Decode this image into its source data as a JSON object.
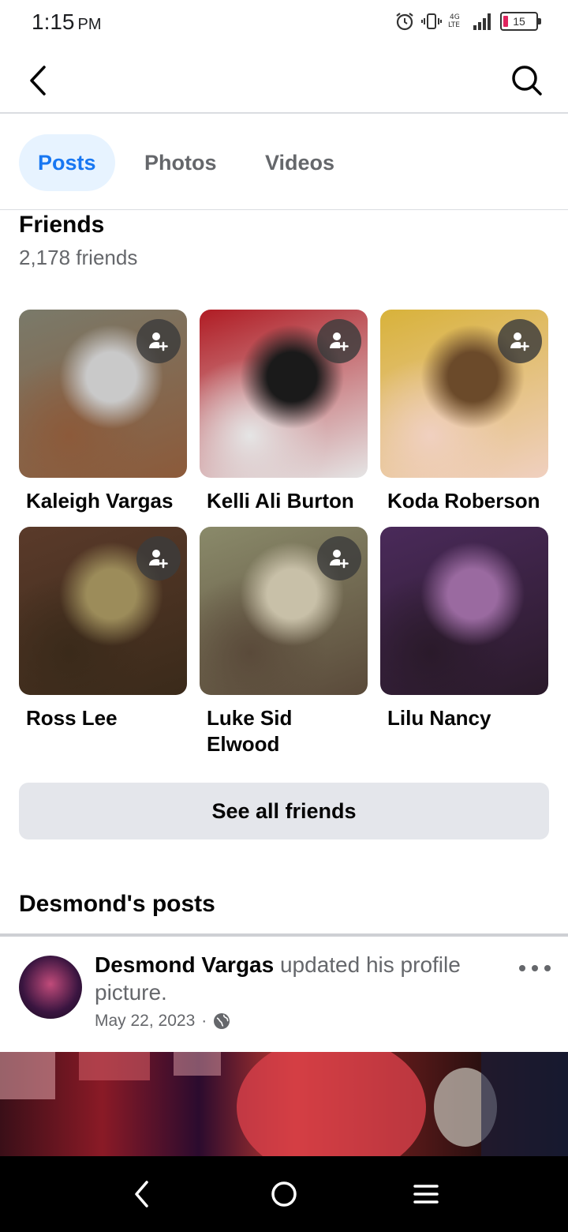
{
  "status_bar": {
    "time": "1:15",
    "ampm": "PM",
    "battery": "15"
  },
  "nav": {
    "back_icon": "chevron-left-icon",
    "search_icon": "search-icon"
  },
  "tabs": [
    {
      "label": "Posts",
      "active": true
    },
    {
      "label": "Photos",
      "active": false
    },
    {
      "label": "Videos",
      "active": false
    }
  ],
  "friends": {
    "title": "Friends",
    "count": "2,178 friends",
    "list": [
      {
        "name": "Kaleigh Vargas",
        "show_add": true,
        "palette": [
          "#7a7a6a",
          "#c9c9c9",
          "#8c5a3a"
        ]
      },
      {
        "name": "Kelli Ali Burton",
        "show_add": true,
        "palette": [
          "#b01c24",
          "#1a1a1a",
          "#e5e5e5"
        ]
      },
      {
        "name": "Koda Roberson",
        "show_add": true,
        "palette": [
          "#d8b23a",
          "#6b4a2a",
          "#f0d0c0"
        ]
      },
      {
        "name": "Ross Lee",
        "show_add": true,
        "palette": [
          "#5a3a2a",
          "#9c8c5a",
          "#3a2a1a"
        ]
      },
      {
        "name": "Luke Sid Elwood",
        "show_add": true,
        "palette": [
          "#8a8a6a",
          "#c8c0a8",
          "#5a4a3a"
        ]
      },
      {
        "name": "Lilu Nancy",
        "show_add": false,
        "palette": [
          "#4a2a5a",
          "#9a6aa0",
          "#2a1a2a"
        ]
      }
    ],
    "see_all_label": "See all friends"
  },
  "posts": {
    "title": "Desmond's posts",
    "items": [
      {
        "author": "Desmond Vargas",
        "action": "updated his profile picture.",
        "date": "May 22, 2023",
        "separator": "·",
        "privacy_icon": "globe-icon"
      }
    ]
  },
  "system_nav": {
    "back": "back-icon",
    "home": "home-icon",
    "menu": "menu-icon"
  }
}
